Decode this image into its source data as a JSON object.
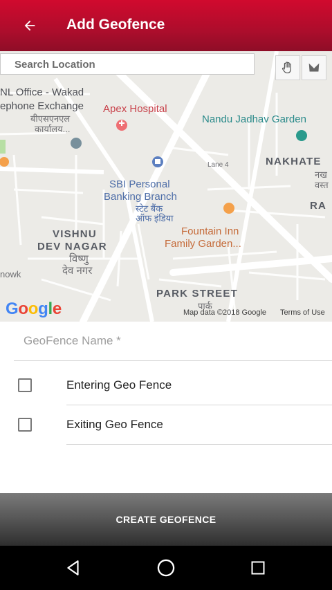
{
  "app_bar": {
    "title": "Add Geofence",
    "back_icon": "arrow-back-icon",
    "background": "#c0102f"
  },
  "search": {
    "placeholder": "Search Location",
    "value": ""
  },
  "map_tools": [
    {
      "icon": "hand-pan-icon"
    },
    {
      "icon": "polygon-draw-icon"
    }
  ],
  "map": {
    "labels": {
      "nl_office_line1": "NL Office - Wakad",
      "nl_office_line2": "ephone Exchange",
      "nl_office_hindi1": "बीएसएनएल",
      "nl_office_hindi2": "कार्यालय...",
      "apex": "Apex Hospital",
      "nandu": "Nandu Jadhav Garden",
      "lane": "Lane 4",
      "nakhate": "NAKHATE",
      "nakhate_hindi1": "नख",
      "nakhate_hindi2": "वस्त",
      "ra": "RA",
      "sbi_line1": "SBI Personal",
      "sbi_line2": "Banking Branch",
      "sbi_hindi1": "स्टेट बैंक",
      "sbi_hindi2": "ऑफ इंडिया",
      "vishnu_line1": "VISHNU",
      "vishnu_line2": "DEV NAGAR",
      "vishnu_hindi1": "विष्णु",
      "vishnu_hindi2": "देव नगर",
      "fountain_line1": "Fountain Inn",
      "fountain_line2": "Family Garden...",
      "park": "PARK STREET",
      "park_hindi": "पार्क",
      "nowk": "nowk"
    },
    "google_logo": "Google",
    "map_data": "Map data ©2018 Google",
    "terms": "Terms of Use"
  },
  "form": {
    "name_placeholder": "GeoFence Name *",
    "name_value": "",
    "entering_label": "Entering Geo Fence",
    "entering_checked": false,
    "exiting_label": "Exiting Geo Fence",
    "exiting_checked": false
  },
  "create_button": "CREATE GEOFENCE",
  "nav": {
    "back_icon": "nav-back-icon",
    "home_icon": "nav-home-icon",
    "recents_icon": "nav-recents-icon"
  }
}
